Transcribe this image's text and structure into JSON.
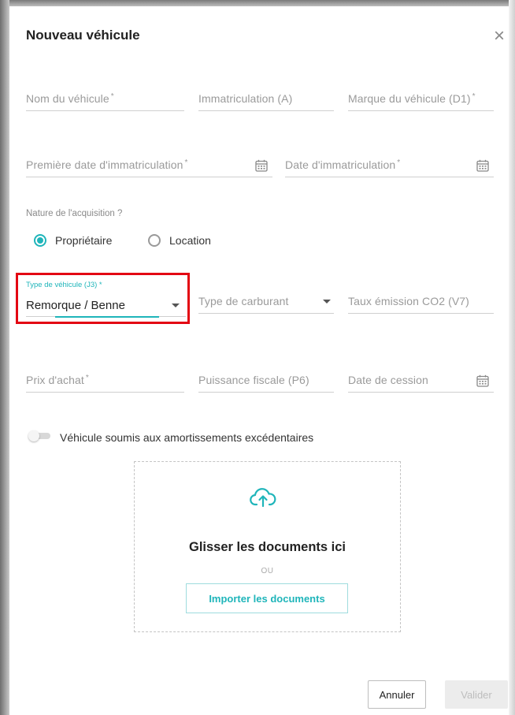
{
  "dialog": {
    "title": "Nouveau véhicule"
  },
  "fields": {
    "nom": {
      "placeholder": "Nom du véhicule",
      "req": "*"
    },
    "immat": {
      "placeholder": "Immatriculation (A)"
    },
    "marque": {
      "placeholder": "Marque du véhicule (D1)",
      "req": "*"
    },
    "premiere_date": {
      "placeholder": "Première date d'immatriculation",
      "req": "*"
    },
    "date_immat": {
      "placeholder": "Date d'immatriculation",
      "req": "*"
    },
    "carburant": {
      "placeholder": "Type de carburant"
    },
    "co2": {
      "placeholder": "Taux émission CO2 (V7)"
    },
    "prix": {
      "placeholder": "Prix d'achat",
      "req": "*"
    },
    "puissance": {
      "placeholder": "Puissance fiscale (P6)"
    },
    "cession": {
      "placeholder": "Date de cession"
    }
  },
  "acquisition": {
    "label": "Nature de l'acquisition ?",
    "options": [
      {
        "label": "Propriétaire",
        "selected": true
      },
      {
        "label": "Location",
        "selected": false
      }
    ]
  },
  "type_vehicule": {
    "label": "Type de véhicule (J3) *",
    "value": "Remorque / Benne"
  },
  "amortissement": {
    "label": "Véhicule soumis aux amortissements excédentaires",
    "on": false
  },
  "dropzone": {
    "title": "Glisser les documents ici",
    "or": "OU",
    "import_label": "Importer les documents"
  },
  "actions": {
    "cancel": "Annuler",
    "validate": "Valider"
  },
  "colors": {
    "accent": "#1fb5ba",
    "highlight": "#e30613"
  },
  "icons": [
    "close-icon",
    "calendar-icon",
    "chevron-down-icon",
    "cloud-upload-icon"
  ]
}
